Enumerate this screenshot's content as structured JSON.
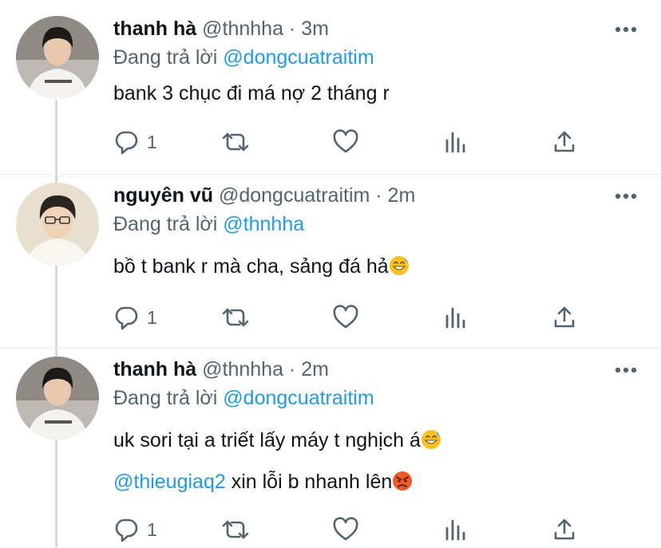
{
  "tweets": [
    {
      "name": "thanh hà",
      "handle": "@thnhha",
      "time": "3m",
      "reply_prefix": "Đang trả lời",
      "reply_to": "@dongcuatraitim",
      "text": "bank 3 chục đi má nợ 2 tháng r",
      "reply_count": "1"
    },
    {
      "name": "nguyên vũ",
      "handle": "@dongcuatraitim",
      "time": "2m",
      "reply_prefix": "Đang trả lời",
      "reply_to": "@thnhha",
      "text": "bồ t bank r mà cha, sảng đá hả",
      "text_emoji": "grinning-sweat-emoji",
      "reply_count": "1"
    },
    {
      "name": "thanh hà",
      "handle": "@thnhha",
      "time": "2m",
      "reply_prefix": "Đang trả lời",
      "reply_to": "@dongcuatraitim",
      "text": "uk sori tại a triết lấy máy t nghịch á",
      "text_emoji": "grinning-sweat-emoji",
      "text2_mention": "@thieugiaq2",
      "text2": " xin lỗi b nhanh lên",
      "text2_emoji": "angry-face-emoji",
      "reply_count": "1"
    }
  ],
  "separator": " · ",
  "icons": [
    "reply-icon",
    "retweet-icon",
    "like-icon",
    "analytics-icon",
    "share-icon",
    "more-icon"
  ],
  "colors": {
    "accent": "#1d9bf0",
    "secondary_text": "#536471",
    "icon": "#536471",
    "thread_line": "#cfd9de"
  }
}
